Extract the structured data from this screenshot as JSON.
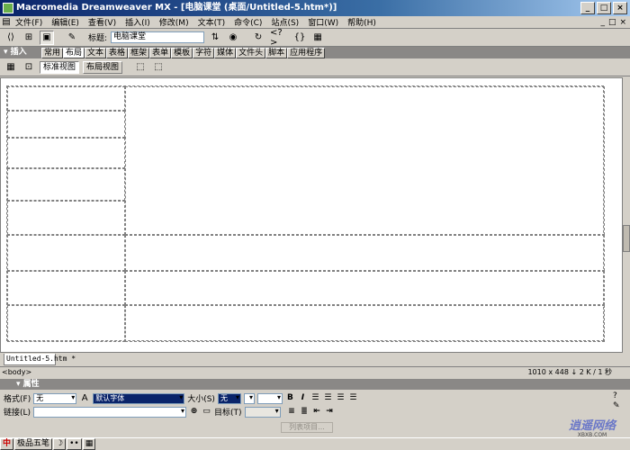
{
  "window": {
    "title": "Macromedia Dreamweaver MX - [电脑课堂 (桌面/Untitled-5.htm*)]",
    "buttons": [
      "_",
      "□",
      "×"
    ]
  },
  "menu": {
    "items": [
      "文件(F)",
      "编辑(E)",
      "查看(V)",
      "插入(I)",
      "修改(M)",
      "文本(T)",
      "命令(C)",
      "站点(S)",
      "窗口(W)",
      "帮助(H)"
    ],
    "doc_controls": [
      "_",
      "□",
      "×"
    ]
  },
  "toolbar": {
    "title_label": "标题:",
    "title_value": "电脑课堂",
    "code_icon_text": "<?>",
    "braces_text": "{}"
  },
  "insert_panel": {
    "label": "插入",
    "tabs": [
      "常用",
      "布局",
      "文本",
      "表格",
      "框架",
      "表单",
      "模板",
      "字符",
      "媒体",
      "文件头",
      "脚本",
      "应用程序"
    ],
    "active_tab": "布局"
  },
  "layout_bar": {
    "standard_view": "标准视图",
    "layout_view": "布局视图"
  },
  "document": {
    "tab_label": "Untitled-5.htm *"
  },
  "status": {
    "tag": "<body>",
    "info": "1010 x 448 ↓ 2 K / 1 秒"
  },
  "properties": {
    "panel_title": "属性",
    "format_label": "格式(F)",
    "format_value": "无",
    "font_value": "默认字体",
    "size_label": "大小(S)",
    "size_value": "无",
    "link_label": "链接(L)",
    "link_value": "",
    "target_label": "目标(T)",
    "list_item_button": "列表项目..."
  },
  "taskbar": {
    "items": [
      "中",
      "极品五笔",
      "☽",
      "••",
      "▦"
    ]
  },
  "watermark": {
    "text": "逍遥网络",
    "sub": "XBXB.COM"
  }
}
